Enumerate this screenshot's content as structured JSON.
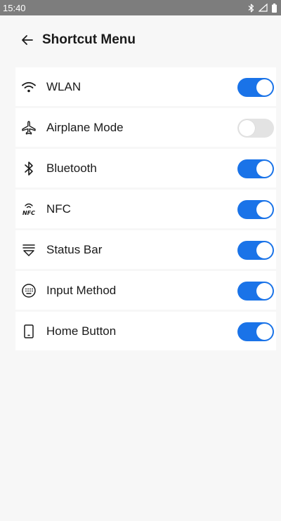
{
  "status_bar": {
    "time": "15:40",
    "icons": [
      "bluetooth-icon",
      "signal-icon",
      "battery-icon"
    ]
  },
  "header": {
    "back_icon": "arrow-left-icon",
    "title": "Shortcut Menu"
  },
  "items": [
    {
      "label": "WLAN",
      "icon": "wifi-icon",
      "enabled": true
    },
    {
      "label": "Airplane Mode",
      "icon": "airplane-icon",
      "enabled": false
    },
    {
      "label": "Bluetooth",
      "icon": "bluetooth-icon",
      "enabled": true
    },
    {
      "label": "NFC",
      "icon": "nfc-icon",
      "enabled": true
    },
    {
      "label": "Status Bar",
      "icon": "status-bar-icon",
      "enabled": true
    },
    {
      "label": "Input Method",
      "icon": "keyboard-icon",
      "enabled": true
    },
    {
      "label": "Home Button",
      "icon": "phone-icon",
      "enabled": true
    }
  ],
  "colors": {
    "accent": "#1a73e8",
    "toggle_off": "#e3e3e3",
    "status_bar_bg": "#7d7d7d",
    "page_bg": "#f7f7f7"
  }
}
